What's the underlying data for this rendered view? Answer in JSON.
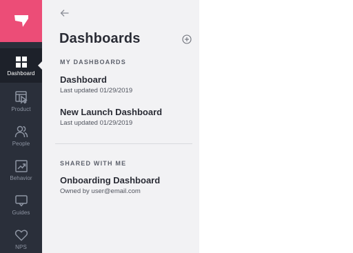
{
  "sidebar": {
    "items": [
      {
        "label": "Dashboard",
        "icon": "grid-icon"
      },
      {
        "label": "Product",
        "icon": "product-cursor-icon"
      },
      {
        "label": "People",
        "icon": "people-icon"
      },
      {
        "label": "Behavior",
        "icon": "trend-chart-icon"
      },
      {
        "label": "Guides",
        "icon": "speech-bubble-icon"
      },
      {
        "label": "NPS",
        "icon": "heart-icon"
      }
    ],
    "active": "Dashboard",
    "brand_color": "#ec4d77",
    "rail_color": "#2a2f3a"
  },
  "panel": {
    "title": "Dashboards",
    "my_section": "MY DASHBOARDS",
    "my_dashboards": [
      {
        "name": "Dashboard",
        "meta": "Last updated 01/29/2019"
      },
      {
        "name": "New Launch Dashboard",
        "meta": "Last updated 01/29/2019"
      }
    ],
    "shared_section": "SHARED WITH ME",
    "shared_dashboards": [
      {
        "name": "Onboarding Dashboard",
        "meta": "Owned by user@email.com"
      }
    ]
  }
}
